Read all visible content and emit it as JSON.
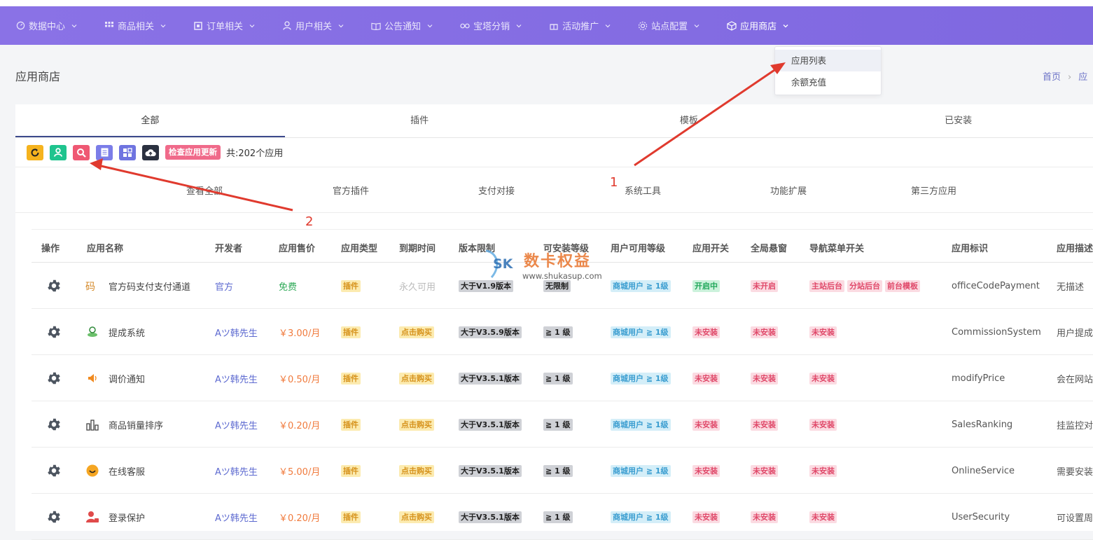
{
  "nav": {
    "items": [
      {
        "label": "数据中心",
        "icon": "gauge-icon"
      },
      {
        "label": "商品相关",
        "icon": "grid-icon"
      },
      {
        "label": "订单相关",
        "icon": "square-icon"
      },
      {
        "label": "用户相关",
        "icon": "user-icon"
      },
      {
        "label": "公告通知",
        "icon": "book-icon"
      },
      {
        "label": "宝塔分销",
        "icon": "link-icon"
      },
      {
        "label": "活动推广",
        "icon": "gift-icon"
      },
      {
        "label": "站点配置",
        "icon": "gear-icon"
      },
      {
        "label": "应用商店",
        "icon": "cube-icon"
      }
    ],
    "dropdown": [
      "应用列表",
      "余额充值"
    ]
  },
  "page": {
    "title": "应用商店",
    "breadcrumb_home": "首页",
    "breadcrumb_current": "应"
  },
  "tabs": [
    "全部",
    "插件",
    "模板",
    "已安装"
  ],
  "toolbar": {
    "update_label": "检查应用更新",
    "count_text": "共:202个应用"
  },
  "categories": [
    "查看全部",
    "官方插件",
    "支付对接",
    "系统工具",
    "功能扩展",
    "第三方应用"
  ],
  "table": {
    "headers": [
      "操作",
      "应用名称",
      "开发者",
      "应用售价",
      "应用类型",
      "到期时间",
      "版本限制",
      "可安装等级",
      "用户可用等级",
      "应用开关",
      "全局悬窗",
      "导航菜单开关",
      "应用标识",
      "应用描述"
    ],
    "rows": [
      {
        "name": "官方码支付支付通道",
        "dev": "官方",
        "price": "免费",
        "type": "插件",
        "expire": "永久可用",
        "version": "大于V1.9版本",
        "level": "无限制",
        "user_level": "商城用户 ≧ 1级",
        "switch": "开启中",
        "float": "未开启",
        "menu": [
          "主站后台",
          "分站后台",
          "前台模板"
        ],
        "id": "officeCodePayment",
        "desc": "无描述"
      },
      {
        "name": "提成系统",
        "dev": "Aツ韩先生",
        "price": "￥3.00/月",
        "type": "插件",
        "expire": "点击购买",
        "version": "大于V3.5.9版本",
        "level": "≧ 1 级",
        "user_level": "商城用户 ≧ 1级",
        "switch": "未安装",
        "float": "未安装",
        "menu": [
          "未安装"
        ],
        "id": "CommissionSystem",
        "desc": "用户提成"
      },
      {
        "name": "调价通知",
        "dev": "Aツ韩先生",
        "price": "￥0.50/月",
        "type": "插件",
        "expire": "点击购买",
        "version": "大于V3.5.1版本",
        "level": "≧ 1 级",
        "user_level": "商城用户 ≧ 1级",
        "switch": "未安装",
        "float": "未安装",
        "menu": [
          "未安装"
        ],
        "id": "modifyPrice",
        "desc": "会在网站"
      },
      {
        "name": "商品销量排序",
        "dev": "Aツ韩先生",
        "price": "￥0.20/月",
        "type": "插件",
        "expire": "点击购买",
        "version": "大于V3.5.1版本",
        "level": "≧ 1 级",
        "user_level": "商城用户 ≧ 1级",
        "switch": "未安装",
        "float": "未安装",
        "menu": [
          "未安装"
        ],
        "id": "SalesRanking",
        "desc": "挂监控对"
      },
      {
        "name": "在线客服",
        "dev": "Aツ韩先生",
        "price": "￥5.00/月",
        "type": "插件",
        "expire": "点击购买",
        "version": "大于V3.5.1版本",
        "level": "≧ 1 级",
        "user_level": "商城用户 ≧ 1级",
        "switch": "未安装",
        "float": "未安装",
        "menu": [
          "未安装"
        ],
        "id": "OnlineService",
        "desc": "需要安装"
      },
      {
        "name": "登录保护",
        "dev": "Aツ韩先生",
        "price": "￥0.20/月",
        "type": "插件",
        "expire": "点击购买",
        "version": "大于V3.5.1版本",
        "level": "≧ 1 级",
        "user_level": "商城用户 ≧ 1级",
        "switch": "未安装",
        "float": "未安装",
        "menu": [
          "未安装"
        ],
        "id": "UserSecurity",
        "desc": "可设置周"
      }
    ]
  },
  "annotations": [
    "1",
    "2"
  ],
  "watermark": {
    "brand": "SK",
    "text": "数卡权益",
    "url": "www.shukasup.com"
  },
  "colors": {
    "nav": "#8a72e6",
    "accent": "#3c4a8c",
    "danger": "#e0496a",
    "arrow": "#e03a2e"
  }
}
